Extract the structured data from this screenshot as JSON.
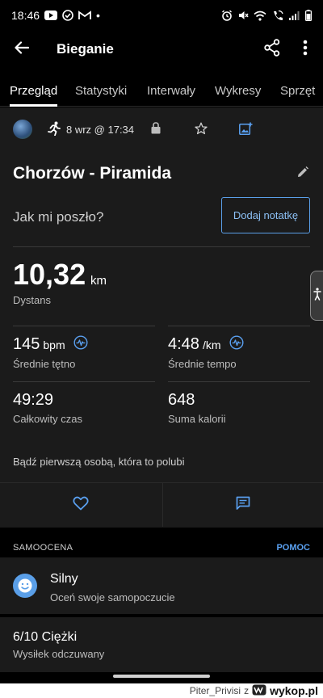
{
  "status_bar": {
    "time": "18:46",
    "dot": "•",
    "left_icons": [
      "youtube-icon",
      "check-circle-icon",
      "gmail-icon"
    ],
    "right_icons": [
      "alarm-icon",
      "mute-icon",
      "wifi-icon",
      "wifi-calling-icon",
      "signal-icon",
      "battery-icon"
    ]
  },
  "app_bar": {
    "title": "Bieganie",
    "icons": [
      "back-arrow-icon",
      "share-icon",
      "more-vert-icon"
    ]
  },
  "tabs": [
    {
      "label": "Przegląd",
      "active": true
    },
    {
      "label": "Statystyki",
      "active": false
    },
    {
      "label": "Interwały",
      "active": false
    },
    {
      "label": "Wykresy",
      "active": false
    },
    {
      "label": "Sprzęt",
      "active": false
    }
  ],
  "meta": {
    "date": "8 wrz @ 17:34",
    "icons": [
      "avatar",
      "running-icon",
      "lock-icon",
      "star-icon",
      "add-photo-icon"
    ]
  },
  "activity": {
    "title": "Chorzów - Piramida"
  },
  "feeling_prompt": {
    "question": "Jak mi poszło?",
    "note_button": "Dodaj notatkę"
  },
  "distance": {
    "value": "10,32",
    "unit": "km",
    "label": "Dystans"
  },
  "stats": {
    "heart_rate": {
      "value": "145",
      "unit": "bpm",
      "label": "Średnie tętno"
    },
    "pace": {
      "value": "4:48",
      "unit": "/km",
      "label": "Średnie tempo"
    },
    "total_time": {
      "value": "49:29",
      "label": "Całkowity czas"
    },
    "calories": {
      "value": "648",
      "label": "Suma kalorii"
    }
  },
  "like_prompt": "Bądź pierwszą osobą, która to polubi",
  "self_assessment": {
    "section_title": "SAMOOCENA",
    "help": "POMOC",
    "feeling": {
      "title": "Silny",
      "subtitle": "Oceń swoje samopoczucie"
    },
    "effort": {
      "title": "6/10 Ciężki",
      "subtitle": "Wysiłek odczuwany"
    }
  },
  "watermark": {
    "user": "Piter_Privisi",
    "prefix": "z",
    "site": "wykop.pl"
  },
  "colors": {
    "background": "#000000",
    "card": "#1b1b1b",
    "accent": "#5a9fe8"
  }
}
